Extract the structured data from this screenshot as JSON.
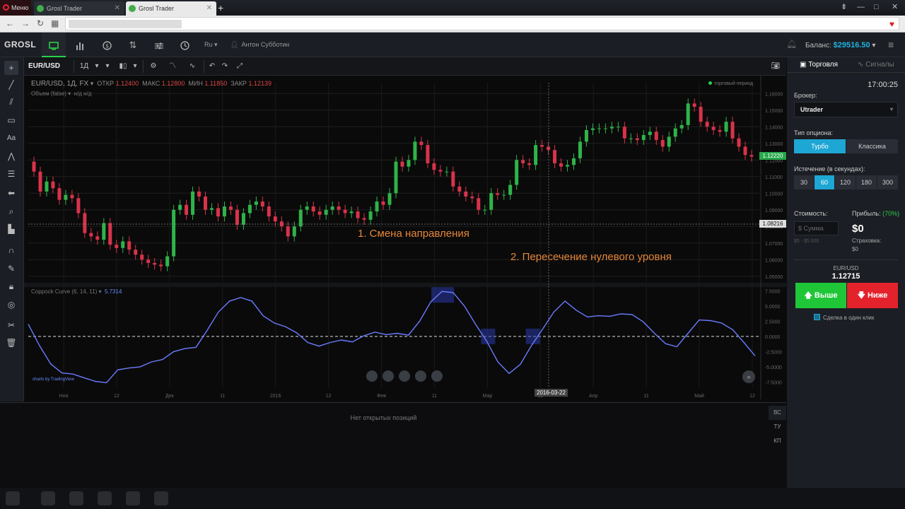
{
  "browser": {
    "menu_label": "Меню",
    "tabs": [
      {
        "title": "Grosl Trader",
        "active": false
      },
      {
        "title": "Grosl Trader",
        "active": true
      }
    ],
    "new_tab": "+",
    "window_controls": [
      "⇟",
      "—",
      "□",
      "✕"
    ]
  },
  "app": {
    "logo": "GROSL",
    "header_icons": [
      "monitor-icon",
      "bar-chart-icon",
      "dollar-icon",
      "arrows-icon",
      "sliders-icon",
      "clock-icon"
    ],
    "lang": "Ru",
    "user": "Антон Субботин",
    "balance_label": "Баланс:",
    "balance_value": "$29516.50"
  },
  "chart_toolbar": {
    "symbol": "EUR/USD",
    "interval": "1Д"
  },
  "chart_legend": {
    "title": "EUR/USD, 1Д, FX",
    "open_label": "ОТКР",
    "open": "1.12400",
    "high_label": "МАКС",
    "high": "1.12800",
    "low_label": "МИН",
    "low": "1.11850",
    "close_label": "ЗАКР",
    "close": "1.12139",
    "volume_label": "Объем (false)",
    "volume_vals": "н/д   н/д",
    "trading_period": "торговый период"
  },
  "indicator": {
    "label": "Coppock Curve (6, 14, 11)",
    "value": "5.7314"
  },
  "annotations": {
    "first": "1. Смена направления",
    "second": "2. Пересечение нулевого уровня"
  },
  "price_tags": {
    "last": "1.12220",
    "cursor": "1.08216"
  },
  "date_flag": "2016-03-22",
  "tv_credit": "charts by TradingView",
  "chart_data": {
    "type": "candlestick",
    "main": {
      "y_ticks": [
        "1.16000",
        "1.15000",
        "1.14000",
        "1.13000",
        "1.12000",
        "1.11000",
        "1.10000",
        "1.09000",
        "1.08000",
        "1.07000",
        "1.06000",
        "1.05000"
      ],
      "ylim": [
        1.0465,
        1.1665
      ],
      "x_ticks": [
        "Ноя",
        "12",
        "Дек",
        "11",
        "2016",
        "12",
        "Фев",
        "11",
        "Мар",
        "11",
        "Апр",
        "11",
        "Май",
        "12"
      ],
      "closes": [
        1.113,
        1.101,
        1.107,
        1.103,
        1.096,
        1.099,
        1.097,
        1.088,
        1.076,
        1.074,
        1.072,
        1.082,
        1.069,
        1.067,
        1.071,
        1.066,
        1.063,
        1.06,
        1.058,
        1.057,
        1.056,
        1.062,
        1.09,
        1.093,
        1.087,
        1.101,
        1.098,
        1.09,
        1.091,
        1.086,
        1.092,
        1.09,
        1.081,
        1.088,
        1.093,
        1.095,
        1.092,
        1.086,
        1.083,
        1.08,
        1.074,
        1.08,
        1.09,
        1.092,
        1.089,
        1.087,
        1.09,
        1.092,
        1.09,
        1.088,
        1.089,
        1.085,
        1.084,
        1.089,
        1.095,
        1.093,
        1.1,
        1.119,
        1.116,
        1.12,
        1.131,
        1.129,
        1.118,
        1.114,
        1.113,
        1.113,
        1.104,
        1.101,
        1.098,
        1.097,
        1.09,
        1.09,
        1.1,
        1.099,
        1.099,
        1.105,
        1.12,
        1.118,
        1.117,
        1.129,
        1.128,
        1.126,
        1.118,
        1.116,
        1.117,
        1.121,
        1.131,
        1.138,
        1.139,
        1.139,
        1.139,
        1.14,
        1.14,
        1.133,
        1.133,
        1.132,
        1.135,
        1.137,
        1.132,
        1.128,
        1.134,
        1.139,
        1.141,
        1.154,
        1.152,
        1.143,
        1.14,
        1.138,
        1.137,
        1.143,
        1.133,
        1.128,
        1.123,
        1.122
      ]
    },
    "coppock": {
      "y_ticks": [
        "7.5000",
        "5.0000",
        "2.5000",
        "0.0000",
        "-2.5000",
        "-5.0000",
        "-7.5000"
      ],
      "ylim": [
        -8.5,
        8.0
      ],
      "values": [
        2.0,
        -1.5,
        -4.5,
        -6.0,
        -6.2,
        -6.8,
        -7.4,
        -7.6,
        -5.5,
        -5.2,
        -5.0,
        -4.2,
        -3.8,
        -2.5,
        -2.0,
        -1.8,
        1.0,
        4.0,
        5.8,
        6.4,
        5.8,
        3.4,
        2.2,
        1.6,
        0.6,
        -1.0,
        -1.6,
        -1.0,
        -0.6,
        -0.9,
        0.1,
        0.7,
        0.3,
        0.5,
        0.2,
        2.5,
        5.7,
        7.4,
        7.2,
        5.0,
        2.0,
        -0.8,
        -4.2,
        -6.1,
        -4.6,
        -1.5,
        1.2,
        4.0,
        5.8,
        4.3,
        3.2,
        3.4,
        3.3,
        3.7,
        3.6,
        2.4,
        0.5,
        -1.2,
        -1.7,
        0.5,
        2.7,
        2.6,
        2.2,
        1.1,
        -1.0,
        -3.2
      ],
      "zero_crossings": [
        -1.6,
        -1.1
      ]
    }
  },
  "right_panel": {
    "tab_trading": "Торговля",
    "tab_signals": "Сигналы",
    "time": "17:00:25",
    "broker_label": "Брокер:",
    "broker_value": "Utrader",
    "option_type_label": "Тип опциона:",
    "option_turbo": "Турбо",
    "option_classic": "Классика",
    "expiry_label": "Истечение (в секундах):",
    "expiry_options": [
      "30",
      "60",
      "120",
      "180",
      "300"
    ],
    "expiry_selected": "60",
    "cost_label": "Стоимость:",
    "sum_placeholder": "$  Сумма",
    "sum_range": "$5 - $5 000",
    "profit_label": "Прибыль:",
    "profit_pct": "(70%)",
    "profit_value": "$0",
    "insurance_label": "Страховка:",
    "insurance_value": "$0",
    "pair": "EUR/USD",
    "pair_price": "1.12715",
    "btn_up": "Выше",
    "btn_down": "Ниже",
    "one_click": "Сделка в один клик"
  },
  "bottom": {
    "no_positions": "Нет открытых позиций",
    "side_tabs": [
      "ВС",
      "ТУ",
      "КП"
    ]
  }
}
